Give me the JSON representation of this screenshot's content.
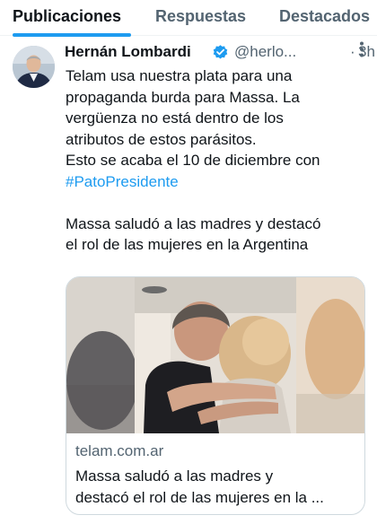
{
  "tabs": [
    {
      "label": "Publicaciones",
      "active": true
    },
    {
      "label": "Respuestas",
      "active": false
    },
    {
      "label": "Destacados",
      "active": false
    }
  ],
  "tweet": {
    "author_name": "Hernán Lombardi",
    "verified_icon": "verified-badge-icon",
    "handle": "@herlo...",
    "separator": "·",
    "time": "3h",
    "more_icon": "more-options-icon",
    "text_lines": [
      "Telam usa nuestra plata para una",
      "propaganda burda para Massa.  La",
      "vergüenza no está dentro de los",
      "atributos de estos parásitos.",
      "Esto se acaba el 10 de diciembre con"
    ],
    "hashtag": "#PatoPresidente",
    "quoted_headline_lines": [
      "Massa saludó a las madres y destacó",
      "el rol de las mujeres en la Argentina"
    ]
  },
  "link_card": {
    "image_icon": "photo-hug-image",
    "domain": "telam.com.ar",
    "title_line1": "Massa saludó a las madres y",
    "title_line2": "destacó el rol de las mujeres en la ..."
  },
  "colors": {
    "accent": "#1d9bf0",
    "text": "#0f1419",
    "secondary": "#536471",
    "border": "#cfd9de"
  }
}
